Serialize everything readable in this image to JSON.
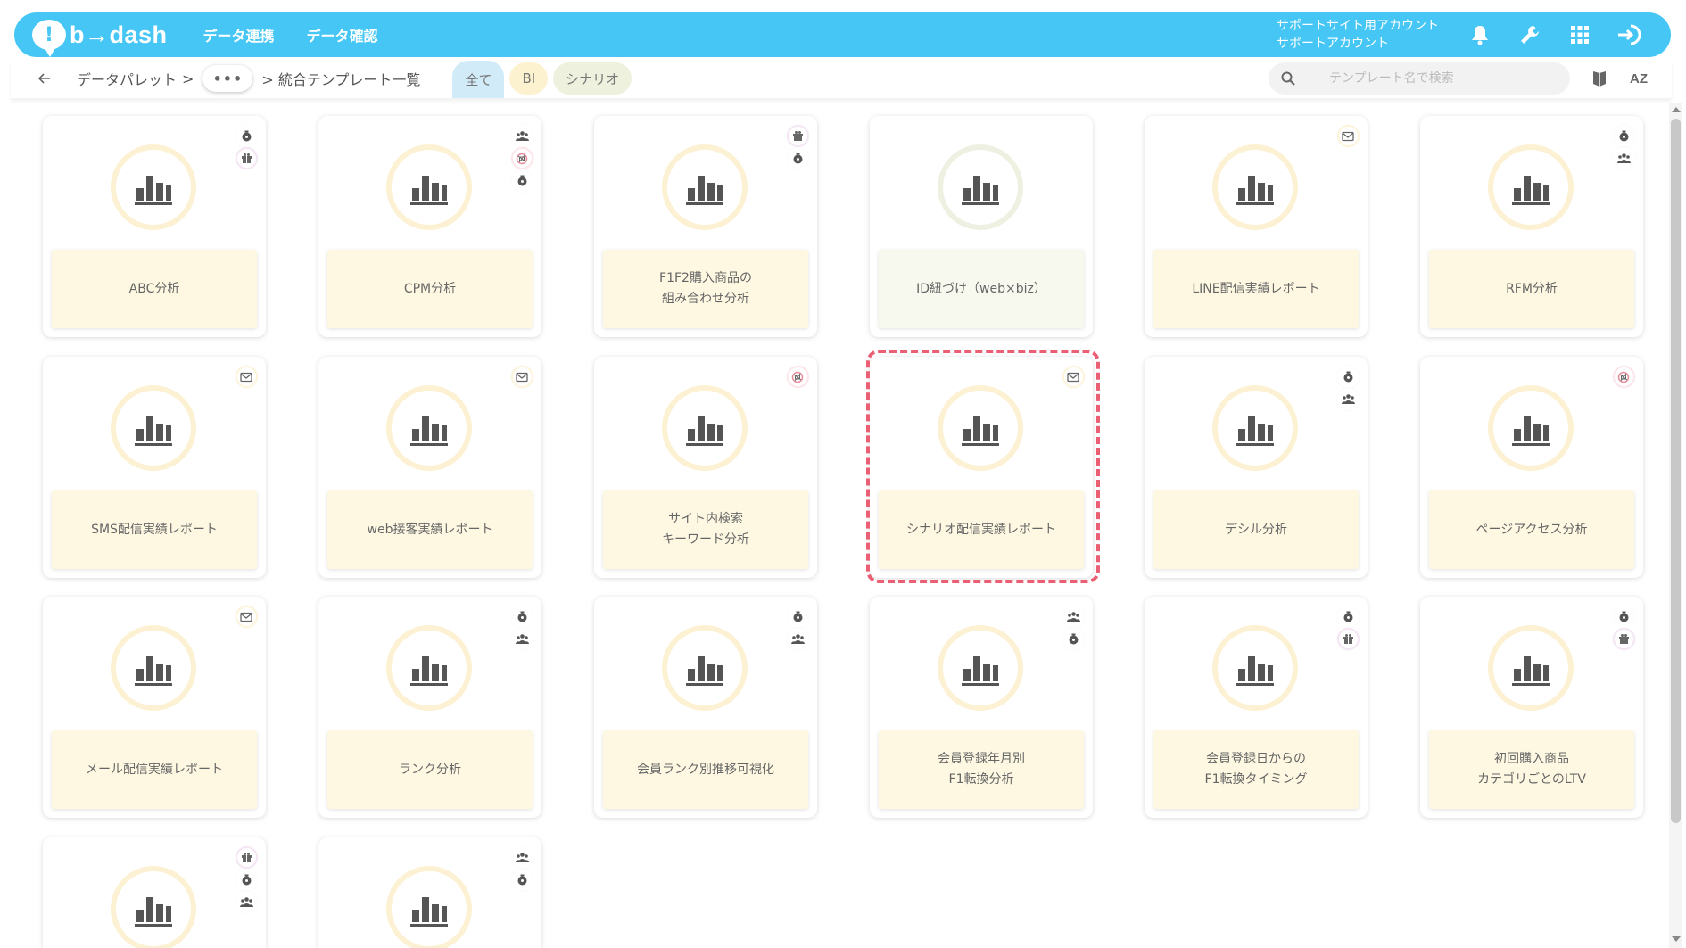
{
  "header": {
    "logo_mark": "!",
    "logo_text": "b→dash",
    "nav": [
      "データ連携",
      "データ確認"
    ],
    "account_line1": "サポートサイト用アカウント",
    "account_line2": "サポートアカウント"
  },
  "toolbar": {
    "crumb_root": "データパレット",
    "crumb_sep": ">",
    "crumb_ellipsis": "•••",
    "crumb_current": "> 統合テンプレート一覧",
    "filters": {
      "all": "全て",
      "bi": "BI",
      "scenario": "シナリオ"
    },
    "search_placeholder": "テンプレート名で検索",
    "sort_label": "AZ"
  },
  "cards": [
    {
      "label": "ABC分析",
      "badges": [
        "coin",
        "gift"
      ]
    },
    {
      "label": "CPM分析",
      "badges": [
        "users",
        "web",
        "coin"
      ]
    },
    {
      "label": "F1F2購入商品の\n組み合わせ分析",
      "badges": [
        "gift",
        "coin"
      ]
    },
    {
      "label": "ID紐づけ（web×biz）",
      "badges": [],
      "green": true
    },
    {
      "label": "LINE配信実績レポート",
      "badges": [
        "mail"
      ]
    },
    {
      "label": "RFM分析",
      "badges": [
        "coin",
        "users"
      ]
    },
    {
      "label": "SMS配信実績レポート",
      "badges": [
        "mail"
      ]
    },
    {
      "label": "web接客実績レポート",
      "badges": [
        "mail"
      ]
    },
    {
      "label": "サイト内検索\nキーワード分析",
      "badges": [
        "web"
      ]
    },
    {
      "label": "シナリオ配信実績レポート",
      "badges": [
        "mail"
      ]
    },
    {
      "label": "デシル分析",
      "badges": [
        "coin",
        "users"
      ]
    },
    {
      "label": "ページアクセス分析",
      "badges": [
        "web"
      ]
    },
    {
      "label": "メール配信実績レポート",
      "badges": [
        "mail"
      ]
    },
    {
      "label": "ランク分析",
      "badges": [
        "coin",
        "users"
      ]
    },
    {
      "label": "会員ランク別推移可視化",
      "badges": [
        "coin",
        "users"
      ]
    },
    {
      "label": "会員登録年月別\nF1転換分析",
      "badges": [
        "users",
        "coin"
      ]
    },
    {
      "label": "会員登録日からの\nF1転換タイミング",
      "badges": [
        "coin",
        "gift"
      ]
    },
    {
      "label": "初回購入商品\nカテゴリごとのLTV",
      "badges": [
        "coin",
        "gift"
      ]
    },
    {
      "label": "",
      "badges": [
        "gift",
        "coin",
        "users"
      ]
    },
    {
      "label": "",
      "badges": [
        "users",
        "coin"
      ]
    }
  ],
  "colors": {
    "header_bg": "#46c6f4",
    "card_label_bg": "#fef8e2",
    "circle_ring": "#fdf1d3",
    "highlight": "#ea5f74",
    "filter_all": "#d2ebf8",
    "filter_bi": "#fdf2cf",
    "filter_scenario": "#eef1dd"
  }
}
